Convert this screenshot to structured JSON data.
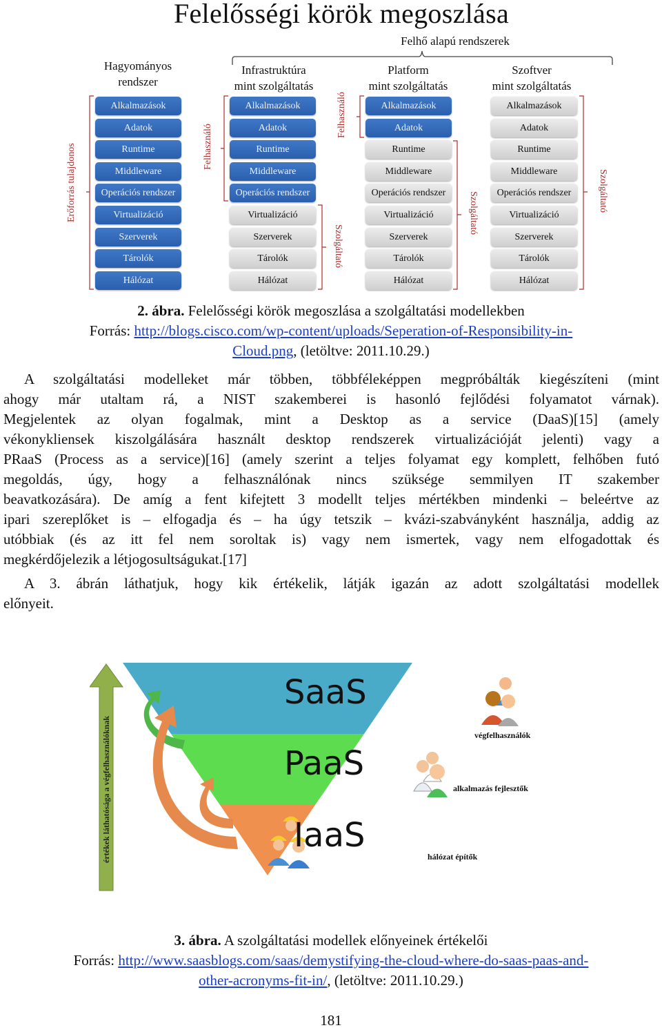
{
  "figure2": {
    "title": "Felelősségi körök megoszlása",
    "cloud_group_label": "Felhő alapú rendszerek",
    "columns": [
      {
        "heading": [
          "Hagyományos",
          "rendszer"
        ],
        "layers": [
          {
            "label": "Alkalmazások",
            "owner": "user"
          },
          {
            "label": "Adatok",
            "owner": "user"
          },
          {
            "label": "Runtime",
            "owner": "user"
          },
          {
            "label": "Middleware",
            "owner": "user"
          },
          {
            "label": "Operációs rendszer",
            "owner": "user"
          },
          {
            "label": "Virtualizáció",
            "owner": "user"
          },
          {
            "label": "Szerverek",
            "owner": "user"
          },
          {
            "label": "Tárolók",
            "owner": "user"
          },
          {
            "label": "Hálózat",
            "owner": "user"
          }
        ],
        "side_labels": [
          "Erőforrás tulajdonos"
        ]
      },
      {
        "heading": [
          "Infrastruktúra",
          "mint szolgáltatás"
        ],
        "layers": [
          {
            "label": "Alkalmazások",
            "owner": "user"
          },
          {
            "label": "Adatok",
            "owner": "user"
          },
          {
            "label": "Runtime",
            "owner": "user"
          },
          {
            "label": "Middleware",
            "owner": "user"
          },
          {
            "label": "Operációs rendszer",
            "owner": "user"
          },
          {
            "label": "Virtualizáció",
            "owner": "provider"
          },
          {
            "label": "Szerverek",
            "owner": "provider"
          },
          {
            "label": "Tárolók",
            "owner": "provider"
          },
          {
            "label": "Hálózat",
            "owner": "provider"
          }
        ],
        "side_labels": [
          "Felhasználó",
          "Szolgáltató"
        ]
      },
      {
        "heading": [
          "Platform",
          "mint szolgáltatás"
        ],
        "layers": [
          {
            "label": "Alkalmazások",
            "owner": "user"
          },
          {
            "label": "Adatok",
            "owner": "user"
          },
          {
            "label": "Runtime",
            "owner": "provider"
          },
          {
            "label": "Middleware",
            "owner": "provider"
          },
          {
            "label": "Operációs rendszer",
            "owner": "provider"
          },
          {
            "label": "Virtualizáció",
            "owner": "provider"
          },
          {
            "label": "Szerverek",
            "owner": "provider"
          },
          {
            "label": "Tárolók",
            "owner": "provider"
          },
          {
            "label": "Hálózat",
            "owner": "provider"
          }
        ],
        "side_labels": [
          "Felhasználó",
          "Szolgáltató"
        ]
      },
      {
        "heading": [
          "Szoftver",
          "mint szolgáltatás"
        ],
        "layers": [
          {
            "label": "Alkalmazások",
            "owner": "provider"
          },
          {
            "label": "Adatok",
            "owner": "provider"
          },
          {
            "label": "Runtime",
            "owner": "provider"
          },
          {
            "label": "Middleware",
            "owner": "provider"
          },
          {
            "label": "Operációs rendszer",
            "owner": "provider"
          },
          {
            "label": "Virtualizáció",
            "owner": "provider"
          },
          {
            "label": "Szerverek",
            "owner": "provider"
          },
          {
            "label": "Tárolók",
            "owner": "provider"
          },
          {
            "label": "Hálózat",
            "owner": "provider"
          }
        ],
        "side_labels": [
          "Szolgáltató"
        ]
      }
    ],
    "colors": {
      "user": "#2f66b5",
      "provider": "#d9d9d9",
      "bracket": "#b22a2a"
    }
  },
  "caption2": {
    "number": "2. ábra.",
    "title": " Felelősségi körök megoszlása a szolgáltatási modellekben",
    "source_prefix": "Forrás: ",
    "link_line1": "http://blogs.cisco.com/wp-content/uploads/Seperation-of-Responsibility-in-",
    "link_line2": "Cloud.png",
    "retrieved": ", (letöltve: 2011.10.29.)"
  },
  "paragraph1": {
    "lines": [
      "A szolgáltatási modelleket már többen, többféleképpen megpróbálták kiegészíteni (mint",
      "ahogy már utaltam rá, a NIST szakemberei is hasonló fejlődési folyamatot várnak).",
      "Megjelentek az olyan fogalmak, mint a Desktop as a service (DaaS)[15] (amely",
      "vékonykliensek kiszolgálására használt desktop rendszerek virtualizációját jelenti) vagy a",
      "PRaaS (Process as a service)[16] (amely szerint a teljes folyamat egy komplett, felhőben futó",
      "megoldás, úgy, hogy a felhasználónak nincs szüksége semmilyen IT szakember",
      "beavatkozására). De amíg a fent kifejtett 3 modellt teljes mértékben mindenki – beleértve az",
      "ipari szereplőket is – elfogadja és – ha úgy tetszik – kvázi-szabványként használja, addig az",
      "utóbbiak (és az itt fel nem soroltak is) vagy nem ismertek, vagy nem elfogadottak és",
      "megkérdőjelezik a létjogosultságukat.[17]"
    ]
  },
  "paragraph2": {
    "lines": [
      "A 3. ábrán láthatjuk, hogy kik értékelik, látják igazán az adott szolgáltatási modellek",
      "előnyeit."
    ]
  },
  "figure3": {
    "tiers": [
      {
        "label": "SaaS",
        "color": "#4aabc9",
        "role": "végfelhasználók"
      },
      {
        "label": "PaaS",
        "color": "#5ddc4f",
        "role": "alkalmazás fejlesztők"
      },
      {
        "label": "IaaS",
        "color": "#f0904e",
        "role": "hálózat építők"
      }
    ],
    "axis_arrow_label": "értékek láthatósága a végfelhasználóknak",
    "axis_arrow_color": "#8fb04a"
  },
  "caption3": {
    "number": "3. ábra.",
    "title": " A szolgáltatási modellek előnyeinek értékelői",
    "source_prefix": "Forrás: ",
    "link_line1": "http://www.saasblogs.com/saas/demystifying-the-cloud-where-do-saas-paas-and-",
    "link_line2": "other-acronyms-fit-in/",
    "retrieved": ", (letöltve: 2011.10.29.)"
  },
  "page_number": "181"
}
